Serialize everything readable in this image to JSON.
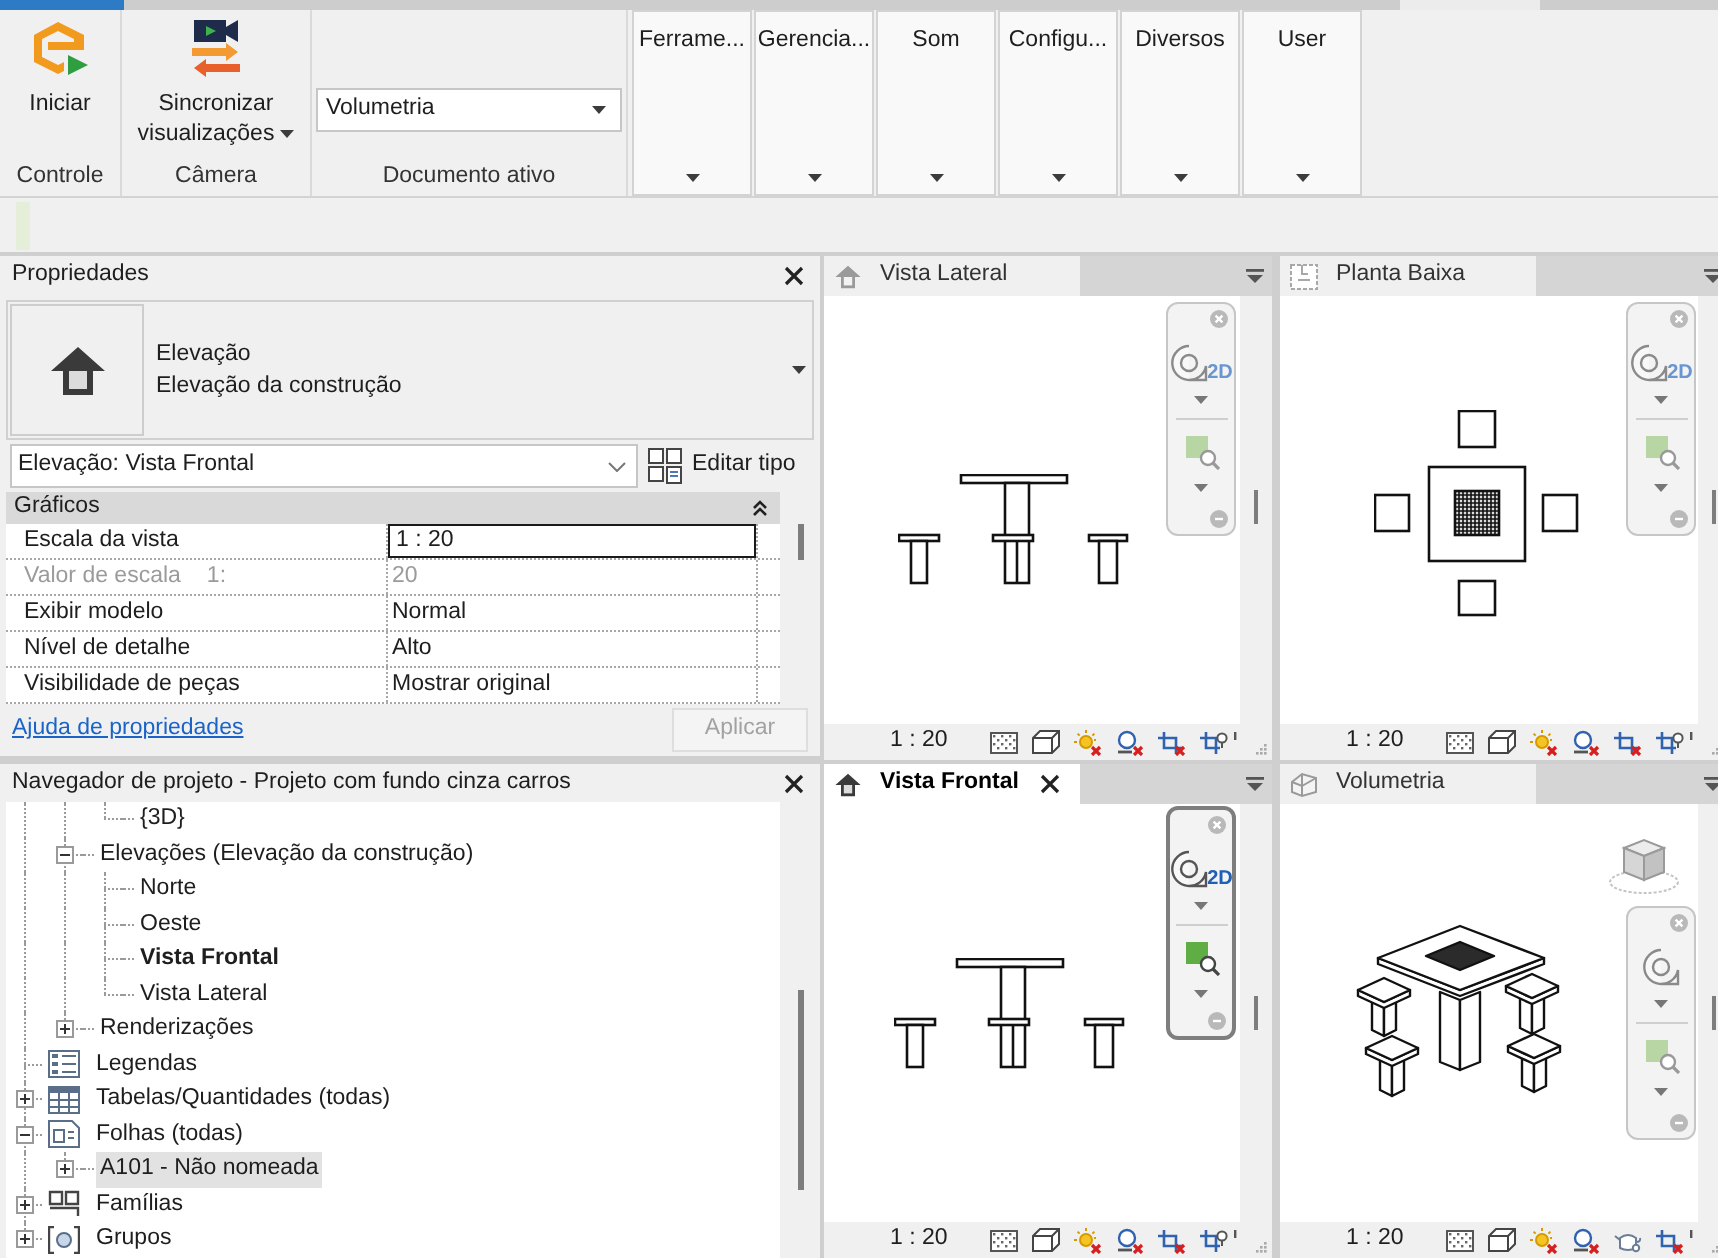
{
  "ribbon": {
    "tabs": [
      {
        "selected": true
      },
      {
        "selected": false
      }
    ],
    "panels": [
      {
        "kind": "button",
        "title": "Controle",
        "button": {
          "label": "Iniciar"
        }
      },
      {
        "kind": "button",
        "title": "Câmera",
        "button": {
          "label": "Sincronizar visualizações",
          "dropdown": true
        }
      },
      {
        "kind": "select",
        "title": "Documento ativo",
        "select": {
          "value": "Volumetria"
        }
      }
    ],
    "collapsed_panels": [
      {
        "label": "Ferrame..."
      },
      {
        "label": "Gerencia..."
      },
      {
        "label": "Som"
      },
      {
        "label": "Configu..."
      },
      {
        "label": "Diversos"
      },
      {
        "label": "User"
      }
    ]
  },
  "properties": {
    "title": "Propriedades",
    "type": {
      "category": "Elevação",
      "name": "Elevação da construção"
    },
    "instance": {
      "value": "Elevação: Vista Frontal"
    },
    "edit_type": "Editar tipo",
    "sections": [
      {
        "title": "Gráficos",
        "expanded": true,
        "rows": [
          {
            "label": "Escala da vista",
            "value": "1 : 20",
            "editing": true,
            "disabled": false
          },
          {
            "label": "Valor de escala",
            "suffix": "1:",
            "value": "20",
            "editing": false,
            "disabled": true
          },
          {
            "label": "Exibir modelo",
            "value": "Normal",
            "editing": false,
            "disabled": false
          },
          {
            "label": "Nível de detalhe",
            "value": "Alto",
            "editing": false,
            "disabled": false
          },
          {
            "label": "Visibilidade de peças",
            "value": "Mostrar original",
            "editing": false,
            "disabled": false
          }
        ]
      }
    ],
    "help_link": "Ajuda de propriedades",
    "apply": {
      "label": "Aplicar",
      "disabled": true
    }
  },
  "project_browser": {
    "title": "Navegador de projeto - Projeto com fundo cinza carros",
    "tree": [
      {
        "children": [
          {
            "children": [
              {
                "label": "{3D}",
                "selected": false,
                "active": false
              }
            ]
          },
          {
            "label": "Elevações (Elevação da construção)",
            "expanded": true,
            "selected": false,
            "active": false,
            "children": [
              {
                "label": "Norte",
                "selected": false,
                "active": false
              },
              {
                "label": "Oeste",
                "selected": false,
                "active": false
              },
              {
                "label": "Vista Frontal",
                "selected": false,
                "active": true
              },
              {
                "label": "Vista Lateral",
                "selected": false,
                "active": false
              }
            ]
          },
          {
            "label": "Renderizações",
            "expanded": false,
            "selected": false,
            "active": false
          }
        ]
      },
      {
        "label": "Legendas",
        "kind": "legend",
        "selected": false,
        "active": false
      },
      {
        "label": "Tabelas/Quantidades (todas)",
        "kind": "schedule",
        "expanded": false,
        "selected": false,
        "active": false
      },
      {
        "label": "Folhas (todas)",
        "kind": "sheet",
        "expanded": true,
        "selected": false,
        "active": false,
        "children": [
          {
            "label": "A101 - Não nomeada",
            "expanded": false,
            "selected": true,
            "active": false
          }
        ]
      },
      {
        "label": "Famílias",
        "kind": "family",
        "expanded": false,
        "selected": false,
        "active": false
      },
      {
        "label": "Grupos",
        "kind": "group",
        "expanded": false,
        "selected": false,
        "active": false
      }
    ]
  },
  "views": [
    {
      "title": "Vista Lateral",
      "kind": "elevation",
      "selected": false,
      "nav_label": "2D",
      "scale": "1 : 20"
    },
    {
      "title": "Planta Baixa",
      "kind": "plan",
      "selected": false,
      "nav_label": "2D",
      "scale": "1 : 20"
    },
    {
      "title": "Vista Frontal",
      "kind": "elevation",
      "selected": true,
      "nav_label": "2D",
      "scale": "1 : 20"
    },
    {
      "title": "Volumetria",
      "kind": "isometric",
      "selected": false,
      "scale": "1 : 20"
    }
  ]
}
